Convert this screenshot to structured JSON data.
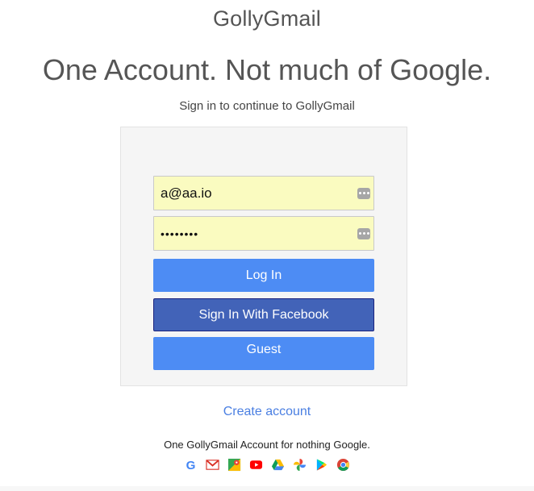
{
  "header": {
    "brand": "GollyGmail",
    "headline": "One Account. Not much of Google.",
    "subtitle": "Sign in to continue to GollyGmail"
  },
  "form": {
    "email_value": "a@aa.io",
    "password_mask": "••••••••",
    "field_icon": "password-manager-icon",
    "login_label": "Log In",
    "facebook_label": "Sign In With Facebook",
    "guest_label": "Guest"
  },
  "links": {
    "create_account": "Create account"
  },
  "footer": {
    "text": "One GollyGmail Account for nothing Google.",
    "app_icons": [
      "google-icon",
      "gmail-icon",
      "maps-icon",
      "youtube-icon",
      "drive-icon",
      "photos-icon",
      "play-store-icon",
      "chrome-icon"
    ]
  },
  "colors": {
    "primary_button": "#4d8cf4",
    "facebook_button": "#4263b8",
    "autofill_field": "#fafbc0",
    "link": "#4a7fe2",
    "card_background": "#f5f5f5"
  }
}
